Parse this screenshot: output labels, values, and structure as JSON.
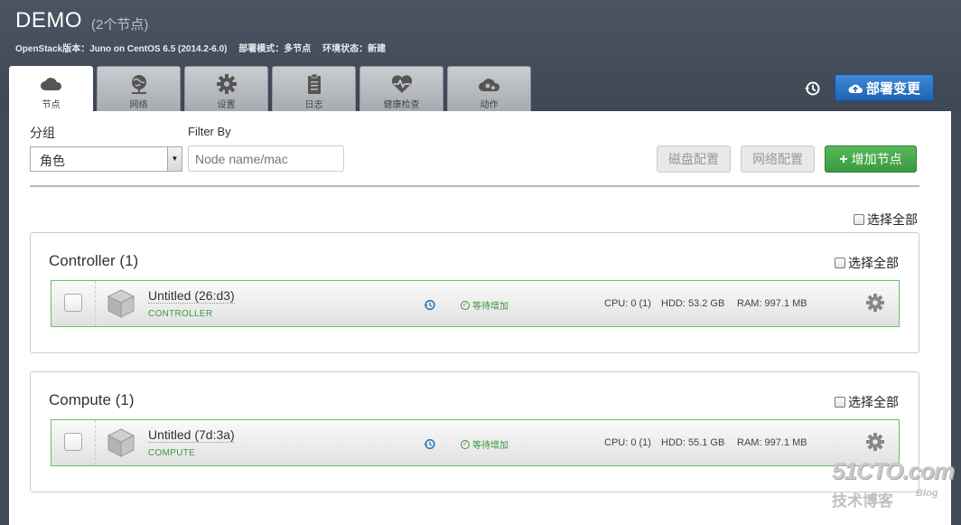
{
  "header": {
    "title": "DEMO",
    "node_count": "(2个节点)",
    "openstack_version": "OpenStack版本：Juno on CentOS 6.5 (2014.2-6.0)",
    "deploy_mode": "部署模式：多节点",
    "env_status": "环境状态：新建",
    "deploy_button": "部署变更"
  },
  "tabs": [
    {
      "label": "节点",
      "icon": "cloud-icon",
      "active": true
    },
    {
      "label": "网络",
      "icon": "globe-network-icon",
      "active": false
    },
    {
      "label": "设置",
      "icon": "gear-icon",
      "active": false
    },
    {
      "label": "日志",
      "icon": "clipboard-icon",
      "active": false
    },
    {
      "label": "健康检查",
      "icon": "heart-pulse-icon",
      "active": false
    },
    {
      "label": "动作",
      "icon": "cloud-gears-icon",
      "active": false
    }
  ],
  "toolbar": {
    "group_label": "分组",
    "group_value": "角色",
    "filter_label": "Filter By",
    "filter_placeholder": "Node name/mac",
    "disk_button": "磁盘配置",
    "network_button": "网络配置",
    "add_node_button": "增加节点",
    "select_all": "选择全部"
  },
  "groups": [
    {
      "title": "Controller (1)",
      "select_all": "选择全部",
      "node": {
        "name": "Untitled (26:d3)",
        "role": "CONTROLLER",
        "status": "等待增加",
        "cpu": "CPU: 0 (1)",
        "hdd": "HDD: 53.2 GB",
        "ram": "RAM: 997.1 MB"
      }
    },
    {
      "title": "Compute (1)",
      "select_all": "选择全部",
      "node": {
        "name": "Untitled (7d:3a)",
        "role": "COMPUTE",
        "status": "等待增加",
        "cpu": "CPU: 0 (1)",
        "hdd": "HDD: 55.1 GB",
        "ram": "RAM: 997.1 MB"
      }
    }
  ],
  "watermark": {
    "main": "51CTO.com",
    "sub": "技术博客",
    "blog": "Blog"
  },
  "colors": {
    "header_bg": "#414b58",
    "deploy_blue": "#2a74c6",
    "add_green": "#48a94c",
    "node_border": "#6dbb6d"
  }
}
